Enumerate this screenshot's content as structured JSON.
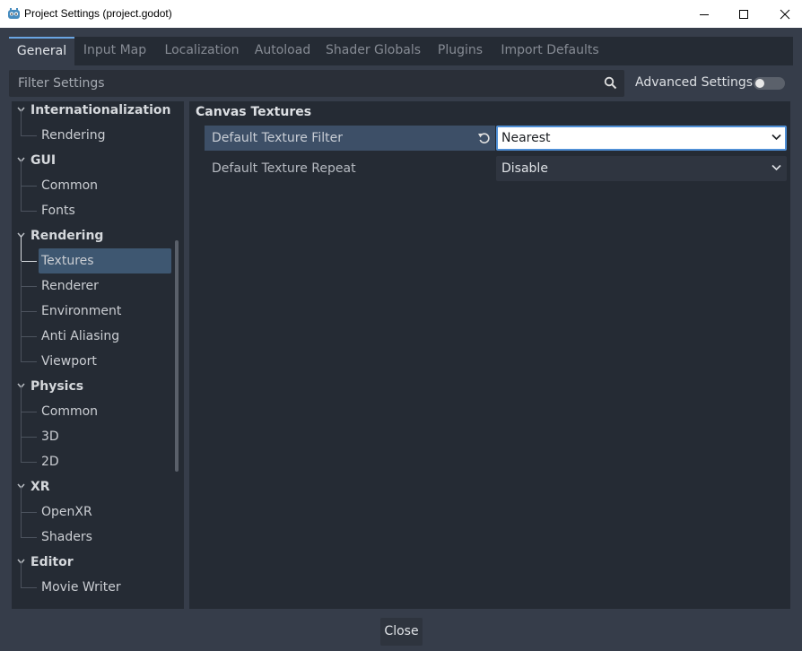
{
  "window": {
    "title": "Project Settings (project.godot)",
    "app_icon": "godot-icon"
  },
  "tabs": [
    {
      "label": "General",
      "active": true
    },
    {
      "label": "Input Map"
    },
    {
      "label": "Localization"
    },
    {
      "label": "Autoload"
    },
    {
      "label": "Shader Globals"
    },
    {
      "label": "Plugins"
    },
    {
      "label": "Import Defaults"
    }
  ],
  "filter": {
    "placeholder": "Filter Settings",
    "advanced_label": "Advanced Settings",
    "advanced_enabled": false
  },
  "tree": [
    {
      "type": "section",
      "label": "Internationalization"
    },
    {
      "type": "item",
      "label": "Rendering"
    },
    {
      "type": "section",
      "label": "GUI"
    },
    {
      "type": "item",
      "label": "Common"
    },
    {
      "type": "item",
      "label": "Fonts"
    },
    {
      "type": "section",
      "label": "Rendering"
    },
    {
      "type": "item",
      "label": "Textures",
      "selected": true
    },
    {
      "type": "item",
      "label": "Renderer"
    },
    {
      "type": "item",
      "label": "Environment"
    },
    {
      "type": "item",
      "label": "Anti Aliasing"
    },
    {
      "type": "item",
      "label": "Viewport"
    },
    {
      "type": "section",
      "label": "Physics"
    },
    {
      "type": "item",
      "label": "Common"
    },
    {
      "type": "item",
      "label": "3D"
    },
    {
      "type": "item",
      "label": "2D"
    },
    {
      "type": "section",
      "label": "XR"
    },
    {
      "type": "item",
      "label": "OpenXR"
    },
    {
      "type": "item",
      "label": "Shaders"
    },
    {
      "type": "section",
      "label": "Editor"
    },
    {
      "type": "item",
      "label": "Movie Writer"
    }
  ],
  "inspector": {
    "category": "Canvas Textures",
    "properties": [
      {
        "name": "Default Texture Filter",
        "value": "Nearest"
      },
      {
        "name": "Default Texture Repeat",
        "value": "Disable"
      }
    ]
  },
  "footer": {
    "close_label": "Close"
  },
  "colors": {
    "accent": "#6aa5e3",
    "selection": "#3e5771",
    "background": "#363d4a",
    "panel": "#252b34"
  }
}
